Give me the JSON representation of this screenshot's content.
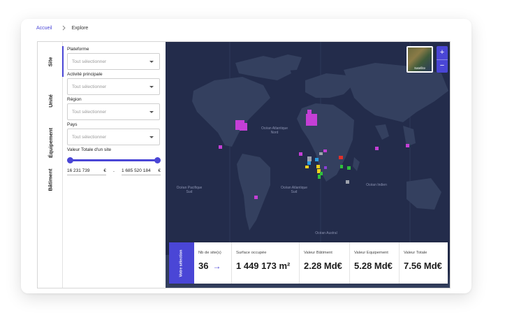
{
  "breadcrumb": {
    "home": "Accueil",
    "current": "Explore"
  },
  "tabs": [
    {
      "label": "Site",
      "active": true
    },
    {
      "label": "Unité",
      "active": false
    },
    {
      "label": "Équipement",
      "active": false
    },
    {
      "label": "Bâtiment",
      "active": false
    }
  ],
  "filters": {
    "plateforme": {
      "label": "Plateforme",
      "placeholder": "Tout sélectionner"
    },
    "activite": {
      "label": "Activité principale",
      "placeholder": "Tout sélectionner"
    },
    "region": {
      "label": "Région",
      "placeholder": "Tout sélectionner"
    },
    "pays": {
      "label": "Pays",
      "placeholder": "Tout sélectionner"
    },
    "valeur": {
      "label": "Valeur Totale d'un site",
      "min": "16 231 739",
      "max": "1 685 520 184",
      "currency": "€",
      "dash": "-"
    }
  },
  "map": {
    "ocean_labels": {
      "atlantique_nord": "Océan Atlantique Nord",
      "pacifique_sud": "Océan Pacifique Sud",
      "atlantique_sud": "Océan Atlantique Sud",
      "indien": "Océan Indien",
      "austral": "Océan Austral"
    },
    "satellite_label": "Satellite",
    "zoom_in": "+",
    "zoom_out": "−",
    "marker_colors": {
      "magenta": "#c43fd6",
      "grey": "#9ea3ad",
      "yellow": "#f2d01e",
      "green": "#2fbf3c",
      "blue": "#2a9be0",
      "red": "#e0302a",
      "purple": "#8a3fd6"
    }
  },
  "stats": {
    "selection_label": "Votre sélection",
    "sites": {
      "label": "Nb de site(s)",
      "value": "36"
    },
    "surface": {
      "label": "Surface occupée",
      "value": "1 449 173 m²"
    },
    "batiment": {
      "label": "Valeur Bâtiment",
      "value": "2.28 Md€"
    },
    "equipement": {
      "label": "Valeur Equipement",
      "value": "5.28 Md€"
    },
    "totale": {
      "label": "Valeur Totale",
      "value": "7.56 Md€"
    }
  },
  "colors": {
    "accent": "#4a46d6",
    "map_bg": "#232c4b",
    "land": "#34405f"
  }
}
